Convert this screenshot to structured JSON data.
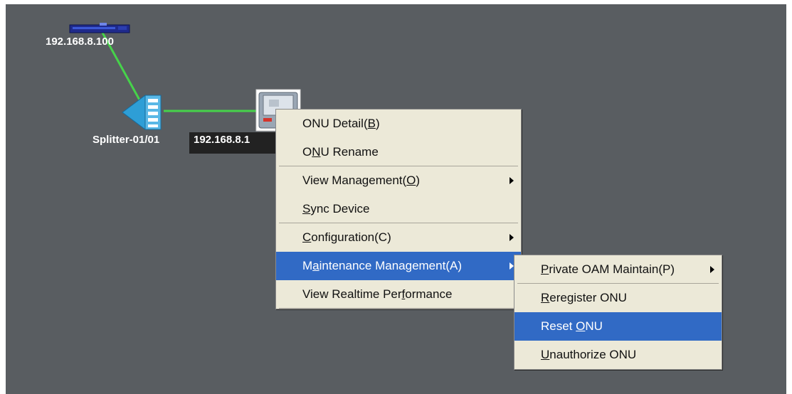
{
  "topology": {
    "olt_label": "192.168.8.100",
    "splitter_label": "Splitter-01/01",
    "onu_label": "192.168.8.1",
    "link_color": "#46d24a",
    "background_color": "#595d61"
  },
  "context_menu": {
    "items": [
      {
        "pre": "ONU Detail(",
        "key": "B",
        "post": ")",
        "submenu": false
      },
      {
        "pre": "O",
        "key": "N",
        "post": "U Rename",
        "submenu": false
      },
      {
        "pre": "View Management(",
        "key": "O",
        "post": ")",
        "submenu": true
      },
      {
        "pre": "",
        "key": "S",
        "post": "ync Device",
        "submenu": false
      },
      {
        "pre": "",
        "key": "C",
        "post": "onfiguration(C)",
        "submenu": true
      },
      {
        "pre": "M",
        "key": "a",
        "post": "intenance Management(A)",
        "submenu": true,
        "selected": true
      },
      {
        "pre": "View Realtime Per",
        "key": "f",
        "post": "ormance",
        "submenu": false
      }
    ]
  },
  "submenu": {
    "items": [
      {
        "pre": "",
        "key": "P",
        "post": "rivate OAM Maintain(P)",
        "submenu": true
      },
      {
        "pre": "",
        "key": "R",
        "post": "eregister ONU",
        "submenu": false
      },
      {
        "pre": "Reset ",
        "key": "O",
        "post": "NU",
        "submenu": false,
        "selected": true
      },
      {
        "pre": "",
        "key": "U",
        "post": "nauthorize ONU",
        "submenu": false
      }
    ]
  },
  "colors": {
    "menu_bg": "#ece9d8",
    "selection": "#316ac5"
  }
}
